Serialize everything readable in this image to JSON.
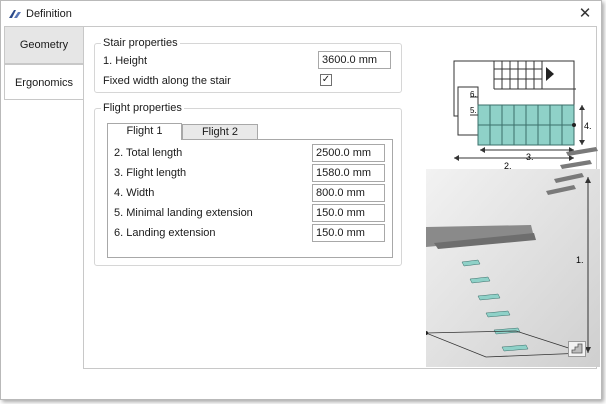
{
  "window": {
    "title": "Definition",
    "close_glyph": "✕"
  },
  "sidebar": {
    "tabs": [
      {
        "label": "Geometry",
        "active": true
      },
      {
        "label": "Ergonomics",
        "active": false
      }
    ]
  },
  "stair_properties": {
    "title": "Stair properties",
    "height_label": "1. Height",
    "height_value": "3600.0 mm",
    "fixed_width_label": "Fixed width along the stair",
    "fixed_width_checked": true,
    "check_glyph": "✓"
  },
  "flight_properties": {
    "title": "Flight properties",
    "tabs": [
      {
        "label": "Flight 1",
        "active": true
      },
      {
        "label": "Flight 2",
        "active": false
      }
    ],
    "rows": [
      {
        "label": "2. Total length",
        "value": "2500.0 mm"
      },
      {
        "label": "3. Flight length",
        "value": "1580.0 mm"
      },
      {
        "label": "4. Width",
        "value": "800.0 mm"
      },
      {
        "label": "5. Minimal landing extension",
        "value": "150.0 mm"
      },
      {
        "label": "6. Landing extension",
        "value": "150.0 mm"
      }
    ]
  },
  "diagram": {
    "labels": {
      "l1": "1.",
      "l2": "2.",
      "l3": "3.",
      "l4": "4.",
      "l5": "5.",
      "l6": "6."
    },
    "tread_color": "#8fd1c8",
    "tread_stroke": "#3b6f6a"
  },
  "icons": {
    "app": "app-logo-icon",
    "close": "close-icon",
    "footer": "stair-preview-icon"
  }
}
